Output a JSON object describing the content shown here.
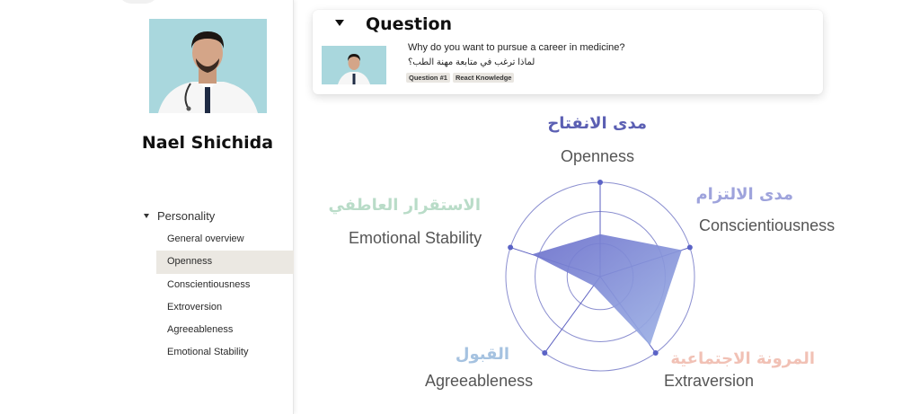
{
  "user": {
    "name": "Nael Shichida"
  },
  "sidebar": {
    "section_label": "Personality",
    "items": [
      {
        "label": "General overview"
      },
      {
        "label": "Openness"
      },
      {
        "label": "Conscientiousness"
      },
      {
        "label": "Extroversion"
      },
      {
        "label": "Agreeableness"
      },
      {
        "label": "Emotional Stability"
      }
    ],
    "active_item": "Openness"
  },
  "question": {
    "title": "Question",
    "text_en": "Why do you want to pursue a career in medicine?",
    "text_ar": "لماذا ترغب في متابعة مهنة الطب؟",
    "tags": [
      "Question #1",
      "React Knowledge"
    ]
  },
  "radar": {
    "axes": [
      {
        "en": "Openness",
        "ar": "مدى الانفتاح",
        "ar_color": "#5b5fb3"
      },
      {
        "en": "Conscientiousness",
        "ar": "مدى الالتزام",
        "ar_color": "#9ea3dc"
      },
      {
        "en": "Extraversion",
        "ar": "المرونة الاجتماعية",
        "ar_color": "#f1c1b5"
      },
      {
        "en": "Agreeableness",
        "ar": "القبول",
        "ar_color": "#a5c2e0"
      },
      {
        "en": "Emotional Stability",
        "ar": "الاستقرار العاطفي",
        "ar_color": "#b9dcc8"
      }
    ],
    "values": [
      0.45,
      0.91,
      0.9,
      0.12,
      0.76
    ],
    "colors": {
      "fill_start": "#6b6fcb",
      "fill_end": "#9fb4e6",
      "ring": "#8b8fd0",
      "spoke": "#5b5fc0",
      "dot": "#5b63c6"
    }
  }
}
